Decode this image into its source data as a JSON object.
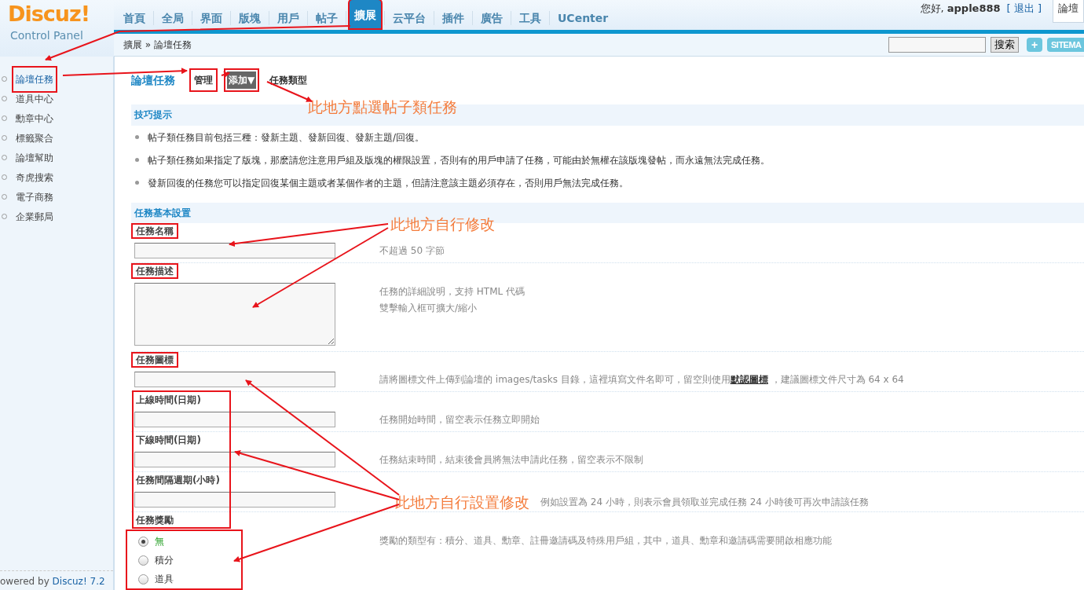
{
  "header": {
    "logo": "Discuz!",
    "logo_sub": "Control Panel",
    "nav": [
      {
        "label": "首頁",
        "selected": false,
        "boxed": false
      },
      {
        "label": "全局",
        "selected": false,
        "boxed": false
      },
      {
        "label": "界面",
        "selected": false,
        "boxed": false
      },
      {
        "label": "版塊",
        "selected": false,
        "boxed": false
      },
      {
        "label": "用戶",
        "selected": false,
        "boxed": false
      },
      {
        "label": "帖子",
        "selected": false,
        "boxed": false
      },
      {
        "label": "擴展",
        "selected": true,
        "boxed": true
      },
      {
        "label": "云平台",
        "selected": false,
        "boxed": false
      },
      {
        "label": "插件",
        "selected": false,
        "boxed": false
      },
      {
        "label": "廣告",
        "selected": false,
        "boxed": false
      },
      {
        "label": "工具",
        "selected": false,
        "boxed": false
      },
      {
        "label": "UCenter",
        "selected": false,
        "boxed": false
      }
    ],
    "greeting": "您好,",
    "username": "apple888",
    "logout": "[ 退出 ]",
    "shortcut": "論壇"
  },
  "breadcrumb": {
    "text": "擴展 » 論壇任務",
    "search_button": "搜索",
    "plus": "+",
    "sitemap": "SITEMA"
  },
  "sidebar": {
    "items": [
      {
        "label": "論壇任務",
        "selected": true,
        "boxed": true
      },
      {
        "label": "道具中心",
        "selected": false,
        "boxed": false
      },
      {
        "label": "勳章中心",
        "selected": false,
        "boxed": false
      },
      {
        "label": "標籤聚合",
        "selected": false,
        "boxed": false
      },
      {
        "label": "論壇幫助",
        "selected": false,
        "boxed": false
      },
      {
        "label": "奇虎搜索",
        "selected": false,
        "boxed": false
      },
      {
        "label": "電子商務",
        "selected": false,
        "boxed": false
      },
      {
        "label": "企業郵局",
        "selected": false,
        "boxed": false
      }
    ],
    "footer_text": "owered by",
    "footer_link": "Discuz! 7.2"
  },
  "page": {
    "title": "論壇任務",
    "actions": [
      {
        "label": "管理",
        "kind": "link",
        "boxed": true
      },
      {
        "label": "添加▼",
        "kind": "menu",
        "boxed": true
      },
      {
        "label": "任務類型",
        "kind": "link",
        "boxed": false
      }
    ]
  },
  "tips": {
    "title": "技巧提示",
    "items": [
      "帖子類任務目前包括三種：發新主題、發新回復、發新主題/回復。",
      "帖子類任務如果指定了版塊，那麽請您注意用戶組及版塊的權限設置，否則有的用戶申請了任務，可能由於無權在該版塊發帖，而永遠無法完成任務。",
      "發新回復的任務您可以指定回復某個主題或者某個作者的主題，但請注意該主題必須存在，否則用戶無法完成任務。"
    ]
  },
  "settings": {
    "title": "任務基本設置",
    "group_boxed": true,
    "fields": [
      {
        "label": "任務名稱",
        "kind": "input",
        "boxed": true,
        "hint": "不超過 50 字節"
      },
      {
        "label": "任務描述",
        "kind": "textarea",
        "boxed": true,
        "hint": "任務的詳細說明，支持 HTML 代碼",
        "hint_2": "雙擊輸入框可擴大/縮小"
      },
      {
        "label": "任務圖標",
        "kind": "input",
        "boxed": true,
        "hint": "請將圖標文件上傳到論壇的 images/tasks 目錄，這裡填寫文件名即可，留空則使用",
        "hint_link": "默認圖標",
        "hint_after": "，建議圖標文件尺寸為 64 x 64"
      },
      {
        "label": "上線時間(日期)",
        "kind": "input",
        "boxed": false,
        "hint": "任務開始時間，留空表示任務立即開始"
      },
      {
        "label": "下線時間(日期)",
        "kind": "input",
        "boxed": false,
        "hint": "任務結束時間，結束後會員將無法申請此任務，留空表示不限制"
      },
      {
        "label": "任務間隔週期(小時)",
        "kind": "input",
        "boxed": false,
        "note": "此地方自行設置修改",
        "hint": "例如設置為 24 小時，則表示會員領取並完成任務 24 小時後可再次申請該任務"
      },
      {
        "label": "任務獎勵",
        "kind": "radio",
        "boxed": false,
        "options_boxed": true,
        "hint": "獎勵的類型有：積分、道具、勳章、註冊邀請碼及特殊用戶組，其中，道具、勳章和邀請碼需要開啟相應功能",
        "options": [
          {
            "label": "無",
            "selected": true
          },
          {
            "label": "積分",
            "selected": false
          },
          {
            "label": "道具",
            "selected": false
          }
        ]
      }
    ]
  },
  "annotations": [
    "此地方點選帖子類任務",
    "此地方自行修改"
  ]
}
